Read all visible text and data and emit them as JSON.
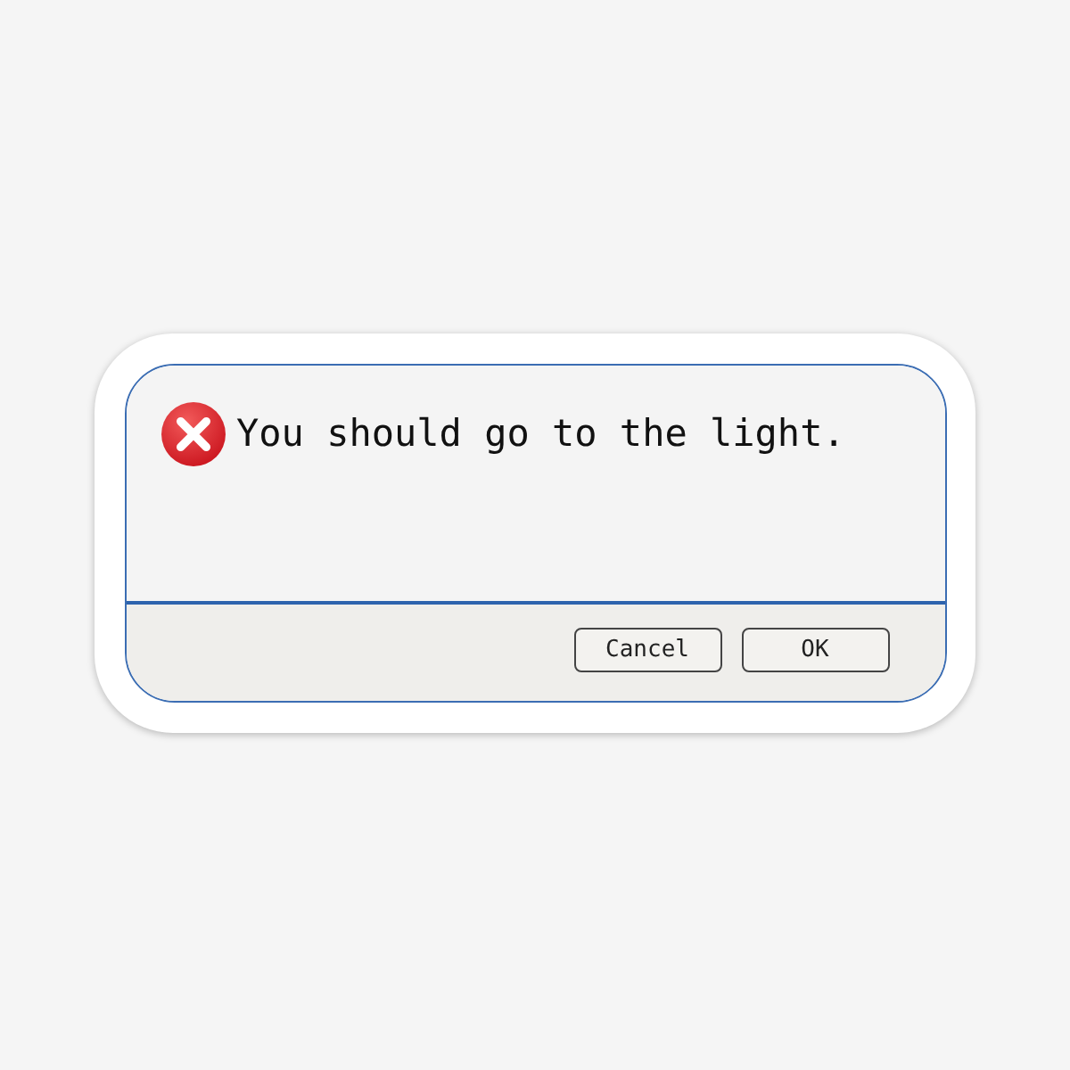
{
  "dialog": {
    "message": "You should go to the light.",
    "buttons": [
      {
        "label": "Cancel"
      },
      {
        "label": "OK"
      }
    ]
  }
}
